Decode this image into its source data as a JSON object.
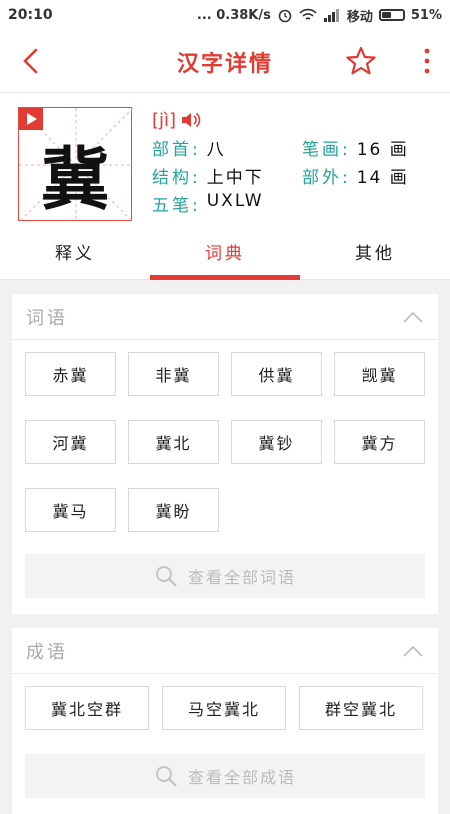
{
  "status": {
    "time": "20:10",
    "speed": "... 0.38K/s",
    "carrier": "移动",
    "battery": "51%",
    "battery_level": 0.51
  },
  "appbar": {
    "title": "汉字详情",
    "back_icon": "chevron-left-icon",
    "star_icon": "star-outline-icon",
    "more_icon": "more-vertical-icon"
  },
  "character": {
    "glyph": "冀",
    "pinyin": "[jì]",
    "radical_label": "部首:",
    "radical": "八",
    "strokes_label": "笔画:",
    "strokes": "16 画",
    "structure_label": "结构:",
    "structure": "上中下",
    "outside_label": "部外:",
    "outside": "14 画",
    "wubi_label": "五笔:",
    "wubi": "UXLW"
  },
  "tabs": [
    {
      "label": "释义",
      "active": false
    },
    {
      "label": "词典",
      "active": true
    },
    {
      "label": "其他",
      "active": false
    }
  ],
  "words_section": {
    "title": "词语",
    "items": [
      "赤冀",
      "非冀",
      "供冀",
      "觊冀",
      "河冀",
      "冀北",
      "冀钞",
      "冀方",
      "冀马",
      "冀盼"
    ],
    "view_all": "查看全部词语"
  },
  "idioms_section": {
    "title": "成语",
    "items": [
      "冀北空群",
      "马空冀北",
      "群空冀北"
    ],
    "view_all": "查看全部成语"
  },
  "colors": {
    "accent": "#e23b33",
    "label": "#24a39a"
  }
}
